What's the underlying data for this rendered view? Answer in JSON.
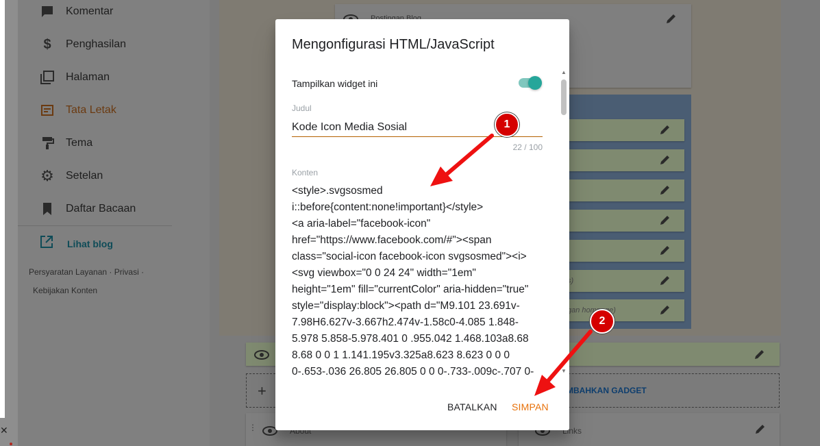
{
  "sidebar": {
    "items": [
      {
        "label": "Komentar",
        "icon": "comment-icon"
      },
      {
        "label": "Penghasilan",
        "icon": "dollar-icon"
      },
      {
        "label": "Halaman",
        "icon": "pages-icon"
      },
      {
        "label": "Tata Letak",
        "icon": "layout-icon"
      },
      {
        "label": "Tema",
        "icon": "paint-roller-icon"
      },
      {
        "label": "Setelan",
        "icon": "gear-icon"
      },
      {
        "label": "Daftar Bacaan",
        "icon": "bookmark-icon"
      }
    ],
    "view_blog": "Lihat blog",
    "footer": {
      "terms": "Persyaratan Layanan",
      "privacy": "Privasi",
      "separator": "·",
      "content_policy": "Kebijakan Konten"
    }
  },
  "layout": {
    "top_gadget_label": "Postingan Blog",
    "gadget_partial_texts": [
      "s)",
      "gan hompage)"
    ],
    "add_gadget_partial": "MBAHKAN GADGET",
    "bottom_left_gadget": "About",
    "bottom_right_gadget": "Links"
  },
  "dialog": {
    "title": "Mengonfigurasi HTML/JavaScript",
    "show_widget_label": "Tampilkan widget ini",
    "show_widget_on": true,
    "title_field_label": "Judul",
    "title_field_value": "Kode Icon Media Sosial",
    "title_counter": "22 / 100",
    "content_label": "Konten",
    "content_lines": [
      "<style>.svgsosmed",
      "i::before{content:none!important}</style>",
      "<a aria-label=\"facebook-icon\"",
      "href=\"https://www.facebook.com/#\"><span",
      "class=\"social-icon facebook-icon svgsosmed\"><i>",
      "<svg viewbox=\"0 0 24 24\" width=\"1em\"",
      "height=\"1em\" fill=\"currentColor\" aria-hidden=\"true\"",
      "style=\"display:block\"><path d=\"M9.101 23.691v-",
      "7.98H6.627v-3.667h2.474v-1.58c0-4.085 1.848-",
      "5.978 5.858-5.978.401 0 .955.042 1.468.103a8.68",
      "8.68 0 0 1 1.141.195v3.325a8.623 8.623 0 0 0",
      "0-.653-.036 26.805 26.805 0 0 0-.733-.009c-.707 0-"
    ],
    "cancel_label": "BATALKAN",
    "save_label": "SIMPAN"
  },
  "annotations": {
    "badge_1": "1",
    "badge_2": "2",
    "arrow_color": "#ee1111"
  },
  "colors": {
    "accent": "#e8710a",
    "toggle": "#26a69a",
    "badge": "#d50000"
  }
}
